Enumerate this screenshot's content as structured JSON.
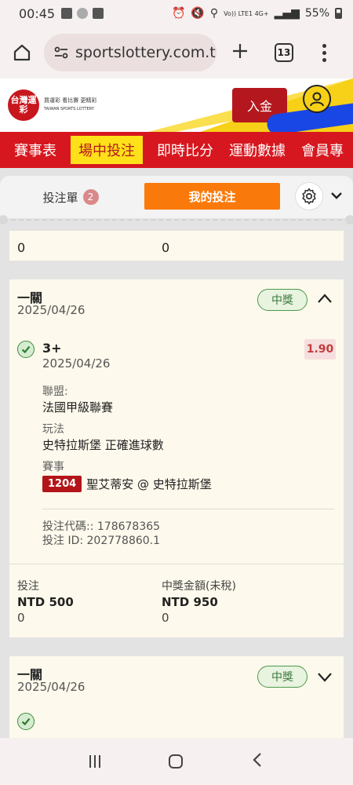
{
  "status_bar": {
    "time": "00:45",
    "network": "Vo)) LTE1 4G+",
    "battery": "55%"
  },
  "browser": {
    "url": "sportslottery.com.tw",
    "tab_count": "13"
  },
  "site": {
    "logo_text": "台灣運彩",
    "logo_sub": "買運彩 看比賽 更精彩",
    "logo_en": "TAIWAN SPORTS LOTTERY",
    "deposit_label": "入金"
  },
  "nav": {
    "items": [
      "賽事表",
      "場中投注",
      "即時比分",
      "運動數據",
      "會員專"
    ]
  },
  "betslip": {
    "tab_label": "投注單",
    "tab_count": "2",
    "mybets_label": "我的投注"
  },
  "prev_card": {
    "stake_value": "0",
    "payout_value": "0"
  },
  "bet_card": {
    "type": "一關",
    "date": "2025/04/26",
    "status": "中獎",
    "selection": "3+",
    "selection_date": "2025/04/26",
    "odds": "1.90",
    "league_label": "聯盟:",
    "league": "法國甲級聯賽",
    "market_label": "玩法",
    "market": "史特拉斯堡 正確進球數",
    "event_label": "賽事",
    "event_code": "1204",
    "event_name": "聖艾蒂安 @ 史特拉斯堡",
    "bet_code": "投注代碼:: 178678365",
    "bet_id": "投注 ID: 202778860.1",
    "stake_label": "投注",
    "stake_amount": "NTD 500",
    "stake_zero": "0",
    "payout_label": "中獎金額(未稅)",
    "payout_amount": "NTD 950",
    "payout_zero": "0"
  },
  "next_card": {
    "type": "一關",
    "date": "2025/04/26",
    "status": "中獎"
  }
}
